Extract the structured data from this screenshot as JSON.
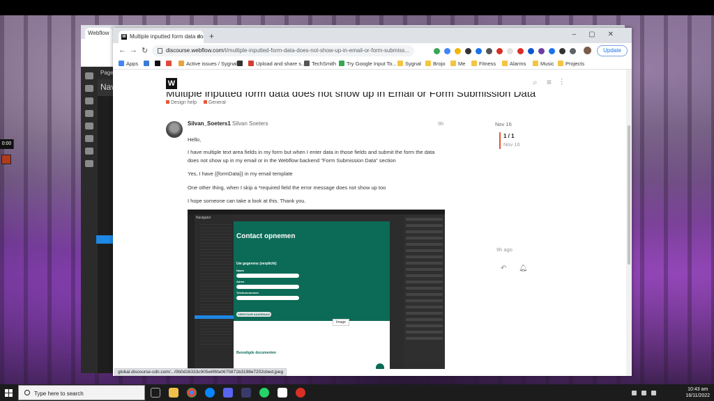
{
  "background_window": {
    "tab_label": "Webflow",
    "page_label": "Page: M",
    "nav_label": "Nav"
  },
  "recording": {
    "timer": "0:00"
  },
  "browser": {
    "tab_title": "Multiple inputted form data doe",
    "url_host": "discourse.webflow.com",
    "url_path": "/t/multiple-inputted-form-data-does-not-show-up-in-email-or-form-submiss...",
    "update_label": "Update",
    "bookmarks": [
      {
        "label": "Apps",
        "color": "#4285f4"
      },
      {
        "label": "",
        "color": "#3b7bd6"
      },
      {
        "label": "",
        "color": "#111111"
      },
      {
        "label": "",
        "color": "#e04a3a"
      },
      {
        "label": "Active issues / Sygnal",
        "color": "#e8a33d"
      },
      {
        "label": "",
        "color": "#333333"
      },
      {
        "label": "Upload and share s...",
        "color": "#d23f31"
      },
      {
        "label": "TechSmith",
        "color": "#555555"
      },
      {
        "label": "Try Google Input To...",
        "color": "#34a853"
      },
      {
        "label": "Sygnal",
        "color": "#f4c542"
      },
      {
        "label": "Brojo",
        "color": "#f4c542"
      },
      {
        "label": "Me",
        "color": "#f4c542"
      },
      {
        "label": "Fitness",
        "color": "#f4c542"
      },
      {
        "label": "Alarms",
        "color": "#f4c542"
      },
      {
        "label": "Music",
        "color": "#f4c542"
      },
      {
        "label": "Projects",
        "color": "#f4c542"
      }
    ],
    "status_url": "global.discourse-cdn.com/.../0b0d16333c905e6f6fa0675871b3198e7202cbed.jpeg"
  },
  "topic": {
    "title": "Multiple inputted form data does not show up in Email or Form Submission Data",
    "categories": [
      {
        "label": "Design help",
        "color": "#e45735"
      },
      {
        "label": "General",
        "color": "#e45735"
      }
    ]
  },
  "post": {
    "username": "Silvan_Soeters1",
    "full_name": "Silvan Soeters",
    "age": "9h",
    "paragraphs": [
      "Hello,",
      "I have multiple text area fields in my form but when I enter data in those fields and submit the form the data does not show up in my email or in the Webflow backend \"Form Submission Data\" section",
      "Yes, I have {{formData}} in my email template",
      "One other thing, when I skip a *required field the error message does not show up too",
      "I hope someone can take a look at this. Thank you."
    ]
  },
  "timeline": {
    "start_date": "Nov 16",
    "count": "1 / 1",
    "current_date": "Nov 16",
    "ago": "9h ago"
  },
  "embedded_image": {
    "heading": "Contact opnemen",
    "sub_heading": "Uw gegevens (verplicht)",
    "field_labels": [
      "Naam",
      "Adres",
      "Telefoonnummer"
    ],
    "button": "VERSTUUR AANVRAAG",
    "tooltip": "Image",
    "docs_heading": "Benodigde documenten",
    "nav_title": "Navigator"
  },
  "taskbar": {
    "search_placeholder": "Type here to search",
    "time": "10:43 am",
    "date": "16/11/2022"
  }
}
